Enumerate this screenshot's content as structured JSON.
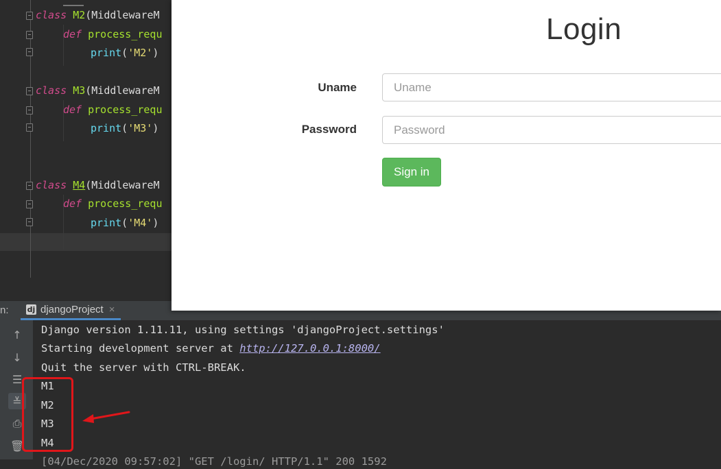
{
  "editor": {
    "classes": [
      {
        "keyword": "class",
        "name": "M2",
        "base": "(MiddlewareM",
        "def_kw": "def",
        "method": "process_requ",
        "print_fn": "print",
        "open_paren": "(",
        "string": "'M2'",
        "close_paren": ")"
      },
      {
        "keyword": "class",
        "name": "M3",
        "base": "(MiddlewareM",
        "def_kw": "def",
        "method": "process_requ",
        "print_fn": "print",
        "open_paren": "(",
        "string": "'M3'",
        "close_paren": ")"
      },
      {
        "keyword": "class",
        "name": "M4",
        "base": "(MiddlewareM",
        "def_kw": "def",
        "method": "process_requ",
        "print_fn": "print",
        "open_paren": "(",
        "string": "'M4'",
        "close_paren": ")"
      }
    ]
  },
  "run_panel": {
    "label": "n:",
    "tab_icon": "dj",
    "tab_name": "djangoProject",
    "tab_close": "×",
    "toolbar_icons": [
      "arrow-up-icon",
      "arrow-down-icon",
      "soft-wrap-icon",
      "scroll-to-end-icon",
      "print-icon",
      "trash-icon"
    ],
    "console_lines": {
      "line1": "Django version 1.11.11, using settings 'djangoProject.settings'",
      "line2_prefix": "Starting development server at ",
      "line2_link": "http://127.0.0.1:8000/",
      "line3": "Quit the server with CTRL-BREAK.",
      "m1": "M1",
      "m2": "M2",
      "m3": "M3",
      "m4": "M4",
      "line_partial": "[04/Dec/2020 09:57:02] \"GET /login/ HTTP/1.1\" 200 1592"
    }
  },
  "browser": {
    "title": "Login",
    "uname_label": "Uname",
    "uname_placeholder": "Uname",
    "password_label": "Password",
    "password_placeholder": "Password",
    "signin_label": "Sign in"
  },
  "colors": {
    "annotation": "#e0161a",
    "signin_bg": "#5cb85c",
    "editor_bg": "#2b2b2b"
  }
}
